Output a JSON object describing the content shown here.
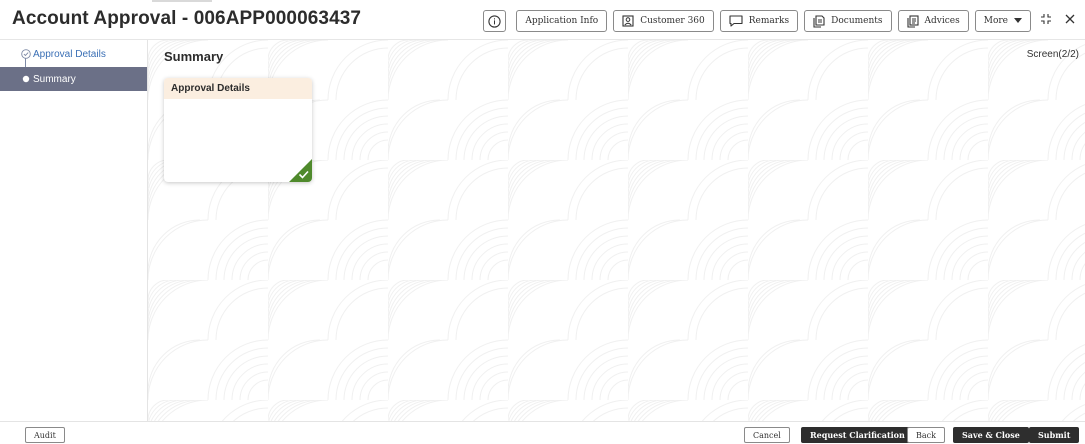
{
  "header": {
    "title": "Account Approval - 006APP000063437",
    "toolbar": [
      {
        "label": "",
        "icon": "info-icon"
      },
      {
        "label": "Application Info",
        "icon": ""
      },
      {
        "label": "Customer 360",
        "icon": "customer-icon"
      },
      {
        "label": "Remarks",
        "icon": "comment-icon"
      },
      {
        "label": "Documents",
        "icon": "document-icon"
      },
      {
        "label": "Advices",
        "icon": "advices-icon"
      },
      {
        "label": "More",
        "icon": "caret-down-icon"
      }
    ],
    "window_controls": [
      "collapse-icon",
      "close-icon"
    ]
  },
  "sidenav": {
    "items": [
      {
        "label": "Approval Details",
        "state": "completed"
      },
      {
        "label": "Summary",
        "state": "active"
      }
    ]
  },
  "main": {
    "section_title": "Summary",
    "screen_indicator": "Screen(2/2)",
    "cards": [
      {
        "title": "Approval Details",
        "status": "completed"
      }
    ]
  },
  "footer": {
    "left_buttons": [
      {
        "label": "Audit"
      }
    ],
    "right_buttons": [
      {
        "label": "Cancel",
        "style": "secondary"
      },
      {
        "label": "Request Clarification",
        "style": "primary"
      },
      {
        "label": "Back",
        "style": "secondary"
      },
      {
        "label": "Save & Close",
        "style": "primary"
      },
      {
        "label": "Submit",
        "style": "primary"
      }
    ]
  },
  "colors": {
    "nav_active_bg": "#6b7087",
    "nav_completed_text": "#3a6fb5",
    "card_header_bg": "#fbeee0",
    "card_check_green": "#4f8a2c",
    "primary_button_bg": "#2e2e2e"
  }
}
